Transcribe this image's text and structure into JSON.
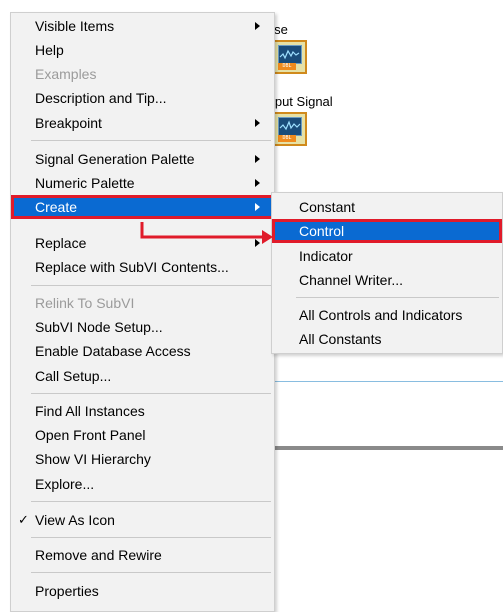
{
  "diagram": {
    "node1_label": "oise",
    "node2_label": "utput Signal",
    "icon_tag": "DBL"
  },
  "context_menu": {
    "items": [
      {
        "label": "Visible Items",
        "submenu": true
      },
      {
        "label": "Help"
      },
      {
        "label": "Examples",
        "disabled": true
      },
      {
        "label": "Description and Tip..."
      },
      {
        "label": "Breakpoint",
        "submenu": true
      },
      {
        "label": "Signal Generation Palette",
        "submenu": true
      },
      {
        "label": "Numeric Palette",
        "submenu": true
      },
      {
        "label": "Create",
        "submenu": true,
        "highlighted": true
      },
      {
        "label": "Replace",
        "submenu": true
      },
      {
        "label": "Replace with SubVI Contents..."
      },
      {
        "label": "Relink To SubVI",
        "disabled": true
      },
      {
        "label": "SubVI Node Setup..."
      },
      {
        "label": "Enable Database Access"
      },
      {
        "label": "Call Setup..."
      },
      {
        "label": "Find All Instances"
      },
      {
        "label": "Open Front Panel"
      },
      {
        "label": "Show VI Hierarchy"
      },
      {
        "label": "Explore..."
      },
      {
        "label": "View As Icon",
        "checked": true,
        "check_mark": "✓"
      },
      {
        "label": "Remove and Rewire"
      },
      {
        "label": "Properties"
      }
    ]
  },
  "create_submenu": {
    "items": [
      {
        "label": "Constant"
      },
      {
        "label": "Control",
        "highlighted": true
      },
      {
        "label": "Indicator"
      },
      {
        "label": "Channel Writer..."
      },
      {
        "label": "All Controls and Indicators"
      },
      {
        "label": "All Constants"
      }
    ]
  },
  "colors": {
    "highlight": "#0a6ad2",
    "annotation_red": "#e01b2a",
    "menu_bg": "#f2f2f2",
    "disabled_text": "#9b9b9b"
  }
}
